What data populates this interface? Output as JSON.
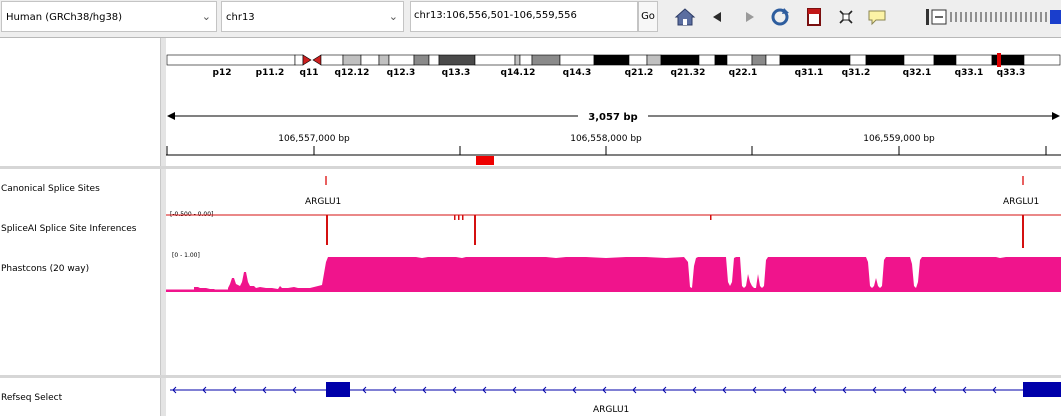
{
  "toolbar": {
    "genome": "Human (GRCh38/hg38)",
    "chromosome": "chr13",
    "locus": "chr13:106,556,501-106,559,556",
    "go_label": "Go",
    "icons": [
      "home-icon",
      "back-icon",
      "forward-icon",
      "refresh-icon",
      "roi-icon",
      "resize-icon",
      "popup-text-icon",
      "zoom-out-icon",
      "zoom-slider",
      "zoom-in-icon"
    ]
  },
  "ideogram": {
    "bands": [
      "p12",
      "p11.2",
      "q11",
      "q12.12",
      "q12.3",
      "q13.3",
      "q14.12",
      "q14.3",
      "q21.2",
      "q21.32",
      "q22.1",
      "q31.1",
      "q31.2",
      "q32.1",
      "q33.1",
      "q33.3"
    ]
  },
  "ruler": {
    "span": "3,057 bp",
    "ticks": [
      "106,557,000 bp",
      "106,558,000 bp",
      "106,559,000 bp"
    ]
  },
  "tracks": {
    "canonical": {
      "name": "Canonical Splice Sites",
      "gene_left": "ARGLU1",
      "gene_right": "ARGLU1",
      "color": "#e86060"
    },
    "spliceai": {
      "name": "SpliceAI Splice Site Inferences",
      "range": "[-0.500 - 0.00]",
      "color": "#d41010"
    },
    "phastcons": {
      "name": "Phastcons (20 way)",
      "range": "[0 - 1.00]",
      "color": "#f0148c"
    },
    "refseq": {
      "name": "Refseq Select",
      "gene": "ARGLU1",
      "color": "#0000aa"
    }
  }
}
